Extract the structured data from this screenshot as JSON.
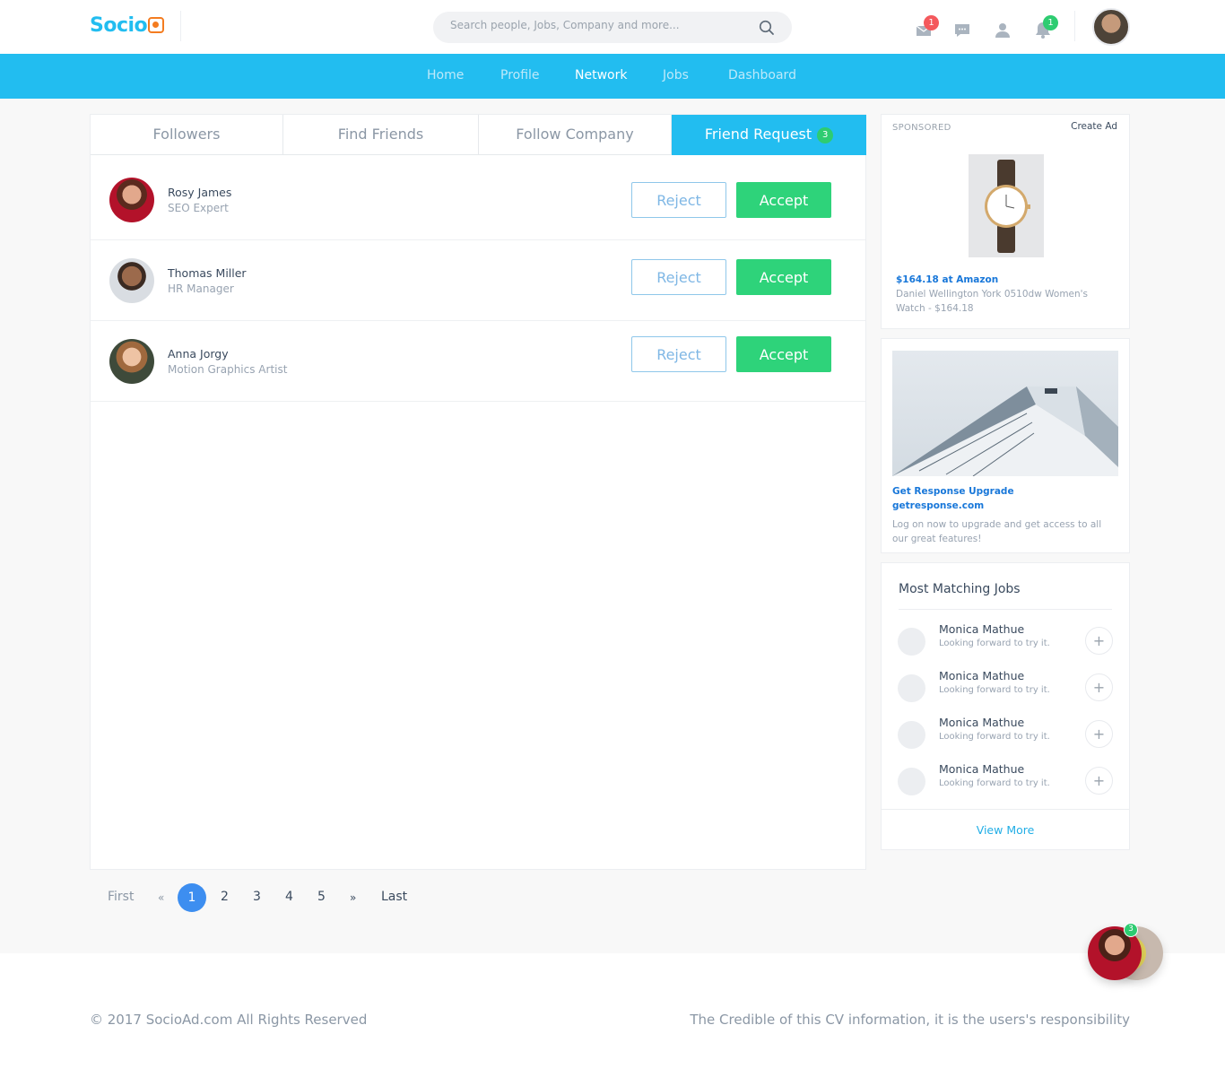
{
  "header": {
    "logo_text": "Socio",
    "search_placeholder": "Search people, Jobs, Company and more...",
    "badges": {
      "messages": "1",
      "notifications": "1"
    }
  },
  "nav": {
    "items": [
      "Home",
      "Profile",
      "Network",
      "Jobs",
      "Dashboard"
    ],
    "active": "Network"
  },
  "tabs": {
    "followers": "Followers",
    "find_friends": "Find Friends",
    "follow_company": "Follow Company",
    "friend_request": "Friend Request",
    "friend_request_count": "3"
  },
  "requests": [
    {
      "name": "Rosy James",
      "role": "SEO Expert",
      "reject": "Reject",
      "accept": "Accept"
    },
    {
      "name": "Thomas Miller",
      "role": "HR Manager",
      "reject": "Reject",
      "accept": "Accept"
    },
    {
      "name": "Anna Jorgy",
      "role": "Motion Graphics Artist",
      "reject": "Reject",
      "accept": "Accept"
    }
  ],
  "pagination": {
    "first": "First",
    "prev": "«",
    "pages": [
      "1",
      "2",
      "3",
      "4",
      "5"
    ],
    "current": "1",
    "next": "»",
    "last": "Last"
  },
  "ads": {
    "sponsored_label": "SPONSORED",
    "create_ad": "Create Ad",
    "watch": {
      "price_link": "$164.18 at Amazon",
      "description": "Daniel Wellington York 0510dw Women's Watch - $164.18"
    },
    "getresponse": {
      "title": "Get Response Upgrade",
      "domain": "getresponse.com",
      "description": "Log on now to upgrade and get access to all our great features!"
    }
  },
  "jobs": {
    "title": "Most Matching Jobs",
    "items": [
      {
        "name": "Monica Mathue",
        "subtitle": "Looking forward to try it."
      },
      {
        "name": "Monica Mathue",
        "subtitle": "Looking forward to try it."
      },
      {
        "name": "Monica Mathue",
        "subtitle": "Looking forward to try it."
      },
      {
        "name": "Monica Mathue",
        "subtitle": "Looking forward to try it."
      }
    ],
    "add_symbol": "+",
    "view_more": "View More"
  },
  "chat": {
    "badge": "3"
  },
  "footer": {
    "copyright": "© 2017 SocioAd.com All Rights Reserved",
    "disclaimer": "The Credible of this CV information, it is the users's responsibility"
  },
  "colors": {
    "brand": "#22bdf0",
    "accept": "#2ed37a",
    "badge_red": "#f4595d",
    "badge_green": "#2ecc71",
    "page_active": "#3d8ef0",
    "logo_accent": "#f47c20"
  }
}
